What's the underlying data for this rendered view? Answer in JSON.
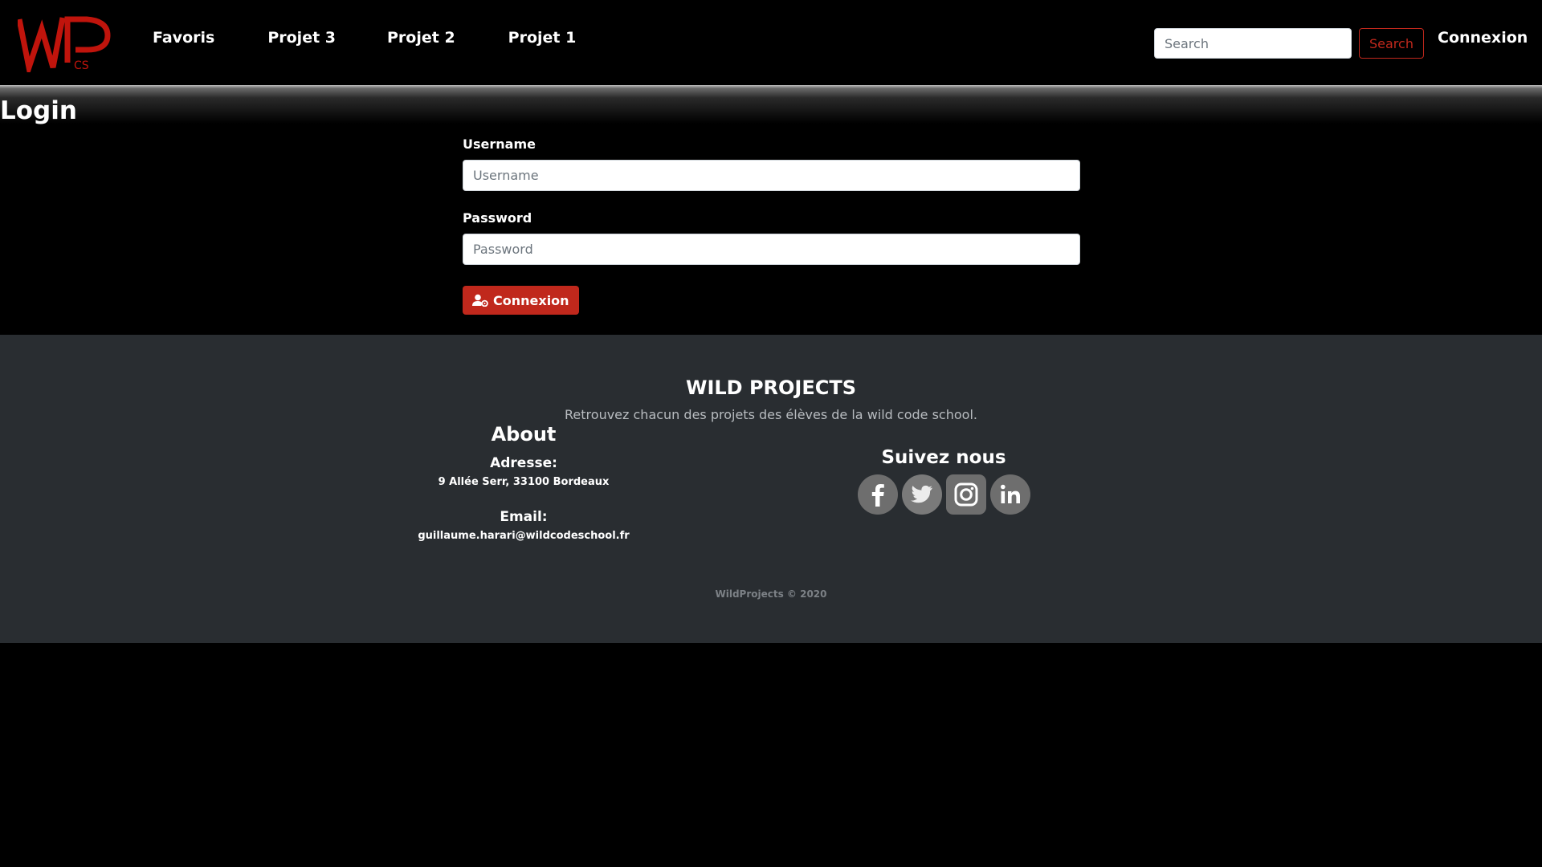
{
  "brand": {
    "logo_main": "WP",
    "logo_sub": "CS",
    "color": "#c0140c"
  },
  "nav": {
    "links": [
      {
        "label": "Favoris"
      },
      {
        "label": "Projet 3"
      },
      {
        "label": "Projet 2"
      },
      {
        "label": "Projet 1"
      }
    ],
    "search_placeholder": "Search",
    "search_button": "Search",
    "login_link": "Connexion"
  },
  "page": {
    "heading": "Login"
  },
  "form": {
    "username_label": "Username",
    "username_placeholder": "Username",
    "password_label": "Password",
    "password_placeholder": "Password",
    "submit_label": "Connexion",
    "submit_icon": "user-cog-icon",
    "accent": "#c0281c"
  },
  "footer": {
    "title": "WILD PROJECTS",
    "description": "Retrouvez chacun des projets des élèves de la wild code school.",
    "about_title": "About",
    "address_label": "Adresse:",
    "address_value": "9 Allée Serr, 33100 Bordeaux",
    "email_label": "Email:",
    "email_value": "guillaume.harari@wildcodeschool.fr",
    "follow_title": "Suivez nous",
    "socials": [
      "facebook-icon",
      "twitter-icon",
      "instagram-icon",
      "linkedin-icon"
    ],
    "copyright": "WildProjects © 2020",
    "background": "#292d31"
  }
}
